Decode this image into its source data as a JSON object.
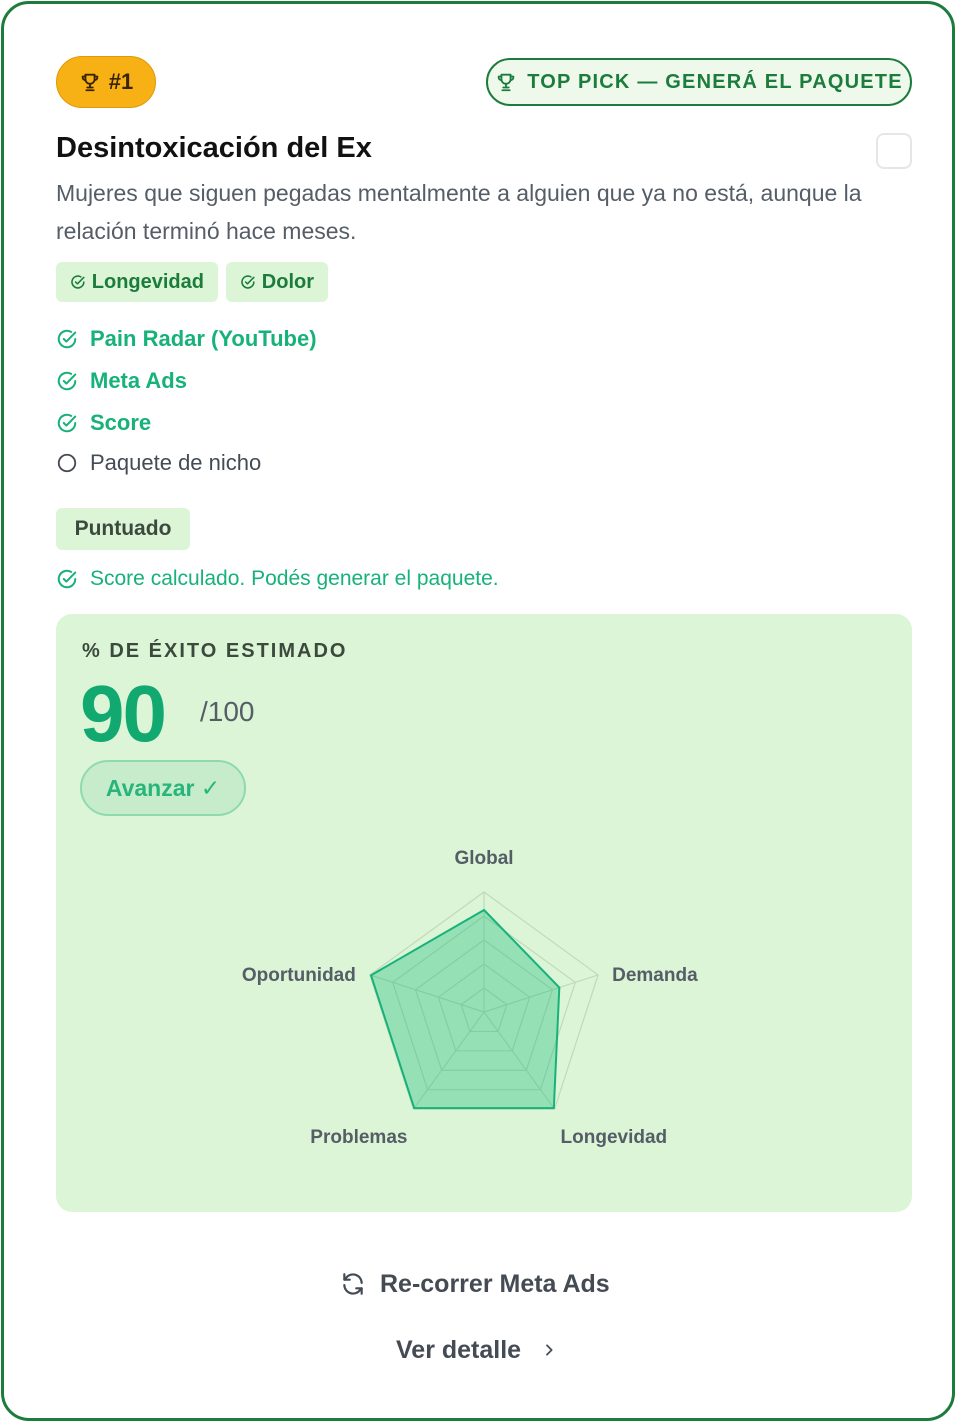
{
  "header": {
    "rank_label": "#1",
    "top_pick_label": "TOP PICK — GENERÁ EL PAQUETE"
  },
  "niche": {
    "title": "Desintoxicación del Ex",
    "description": "Mujeres que siguen pegadas mentalmente a alguien que ya no está, aunque la relación terminó hace meses."
  },
  "tags": [
    {
      "label": "Longevidad"
    },
    {
      "label": "Dolor"
    }
  ],
  "steps": [
    {
      "label": "Pain Radar (YouTube)",
      "done": true
    },
    {
      "label": "Meta Ads",
      "done": true
    },
    {
      "label": "Score",
      "done": true
    },
    {
      "label": "Paquete de nicho",
      "done": false
    }
  ],
  "status": {
    "chip": "Puntuado",
    "message": "Score calculado. Podés generar el paquete."
  },
  "score": {
    "label": "% DE ÉXITO ESTIMADO",
    "value": "90",
    "max": "/100",
    "advance_label": "Avanzar ✓"
  },
  "radar": {
    "max": 100,
    "axes": [
      {
        "label": "Global",
        "value": 85
      },
      {
        "label": "Demanda",
        "value": 66
      },
      {
        "label": "Longevidad",
        "value": 99
      },
      {
        "label": "Problemas",
        "value": 99
      },
      {
        "label": "Oportunidad",
        "value": 99
      }
    ]
  },
  "actions": {
    "rerun_label": "Re-correr Meta Ads",
    "detail_label": "Ver detalle"
  },
  "colors": {
    "brand_green": "#1c7c3c",
    "accent_green": "#17b27a",
    "panel_bg": "#dcf5d6",
    "badge_gold": "#f7b115"
  }
}
